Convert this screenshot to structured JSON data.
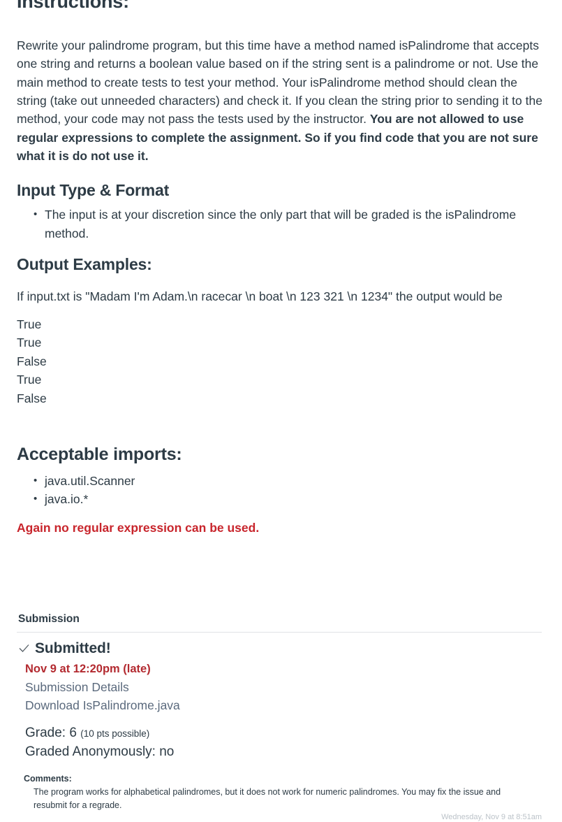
{
  "instructions": {
    "title": "Instructions:",
    "paragraph_normal_1": "Rewrite your palindrome program, but this time have a method named isPalindrome that accepts one string and returns a boolean value based on if the string sent is a palindrome or not. Use the main method to create tests to test your method. Your isPalindrome method should clean the string (take out unneeded characters) and check it. If you clean the string prior to sending it to the method, your code may not pass the tests used by the instructor. ",
    "paragraph_bold_1": "You are not allowed to use regular expressions to complete the assignment. So if you find code that you are not sure what it is do not use it."
  },
  "input_section": {
    "title": "Input Type & Format",
    "bullets": [
      "The input is at your discretion since the only part that will be graded is the isPalindrome method."
    ]
  },
  "output_section": {
    "title": "Output Examples:",
    "intro": "If input.txt is \"Madam I'm Adam.\\n racecar \\n boat \\n 123 321 \\n 1234\" the output would be",
    "lines": [
      "True",
      "True",
      "False",
      "True",
      "False"
    ]
  },
  "imports_section": {
    "title": "Acceptable imports:",
    "bullets": [
      "java.util.Scanner",
      "java.io.*"
    ],
    "warning": "Again no regular expression can be used."
  },
  "submission": {
    "heading": "Submission",
    "status_label": "Submitted!",
    "check_icon": "check-icon",
    "date": "Nov 9 at 12:20pm (late)",
    "details_link": "Submission Details",
    "download_link": "Download IsPalindrome.java"
  },
  "grade": {
    "grade_text": "Grade: 6",
    "points_possible": "(10 pts possible)",
    "anonymous_text": "Graded Anonymously: no"
  },
  "comments": {
    "label": "Comments:",
    "body": "The program works for alphabetical palindromes, but it does not work for numeric palindromes. You may fix the issue and resubmit for a regrade.",
    "timestamp": "Wednesday, Nov 9 at 8:51am"
  },
  "colors": {
    "text": "#2D3B45",
    "warning_red": "#C8252C",
    "date_red": "#B32A30",
    "link": "#5B6A7D",
    "divider": "#E0E3E6"
  }
}
